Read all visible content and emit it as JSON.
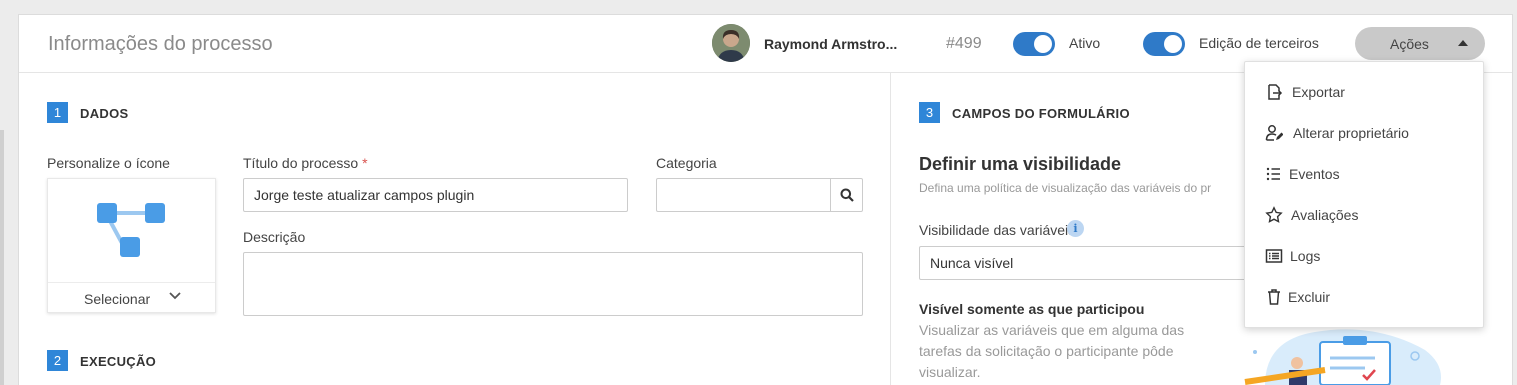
{
  "header": {
    "title": "Informações do processo",
    "owner_name": "Raymond Armstro...",
    "process_id": "#499",
    "active_label": "Ativo",
    "active_on": true,
    "third_party_label": "Edição de terceiros",
    "third_party_on": true,
    "actions_label": "Ações"
  },
  "actions_menu": {
    "items": [
      {
        "label": "Exportar",
        "icon": "export-icon"
      },
      {
        "label": "Alterar proprietário",
        "icon": "change-owner-icon"
      },
      {
        "label": "Eventos",
        "icon": "list-icon"
      },
      {
        "label": "Avaliações",
        "icon": "star-icon"
      },
      {
        "label": "Logs",
        "icon": "logs-icon"
      },
      {
        "label": "Excluir",
        "icon": "trash-icon"
      }
    ]
  },
  "section1": {
    "number": "1",
    "title": "DADOS",
    "icon_label": "Personalize o ícone",
    "icon_select": "Selecionar",
    "process_title_label": "Título do processo",
    "required_mark": "*",
    "process_title_value": "Jorge teste atualizar campos plugin",
    "category_label": "Categoria",
    "category_value": "",
    "description_label": "Descrição",
    "description_value": ""
  },
  "section2": {
    "number": "2",
    "title": "EXECUÇÃO"
  },
  "section3": {
    "number": "3",
    "title": "CAMPOS DO FORMULÁRIO",
    "heading": "Definir uma visibilidade",
    "subtext": "Defina uma política de visualização das variáveis do pr",
    "visibility_label": "Visibilidade das variáveis",
    "info_glyph": "i",
    "visibility_value": "Nunca visível",
    "option_title": "Visível somente as que participou",
    "option_desc": "Visualizar as variáveis que em alguma das tarefas da solicitação o participante pôde visualizar."
  },
  "colors": {
    "accent": "#2f86d8",
    "toggle": "#2f7ac8",
    "required": "#d9534f",
    "button_gray": "#c9c9c9"
  }
}
